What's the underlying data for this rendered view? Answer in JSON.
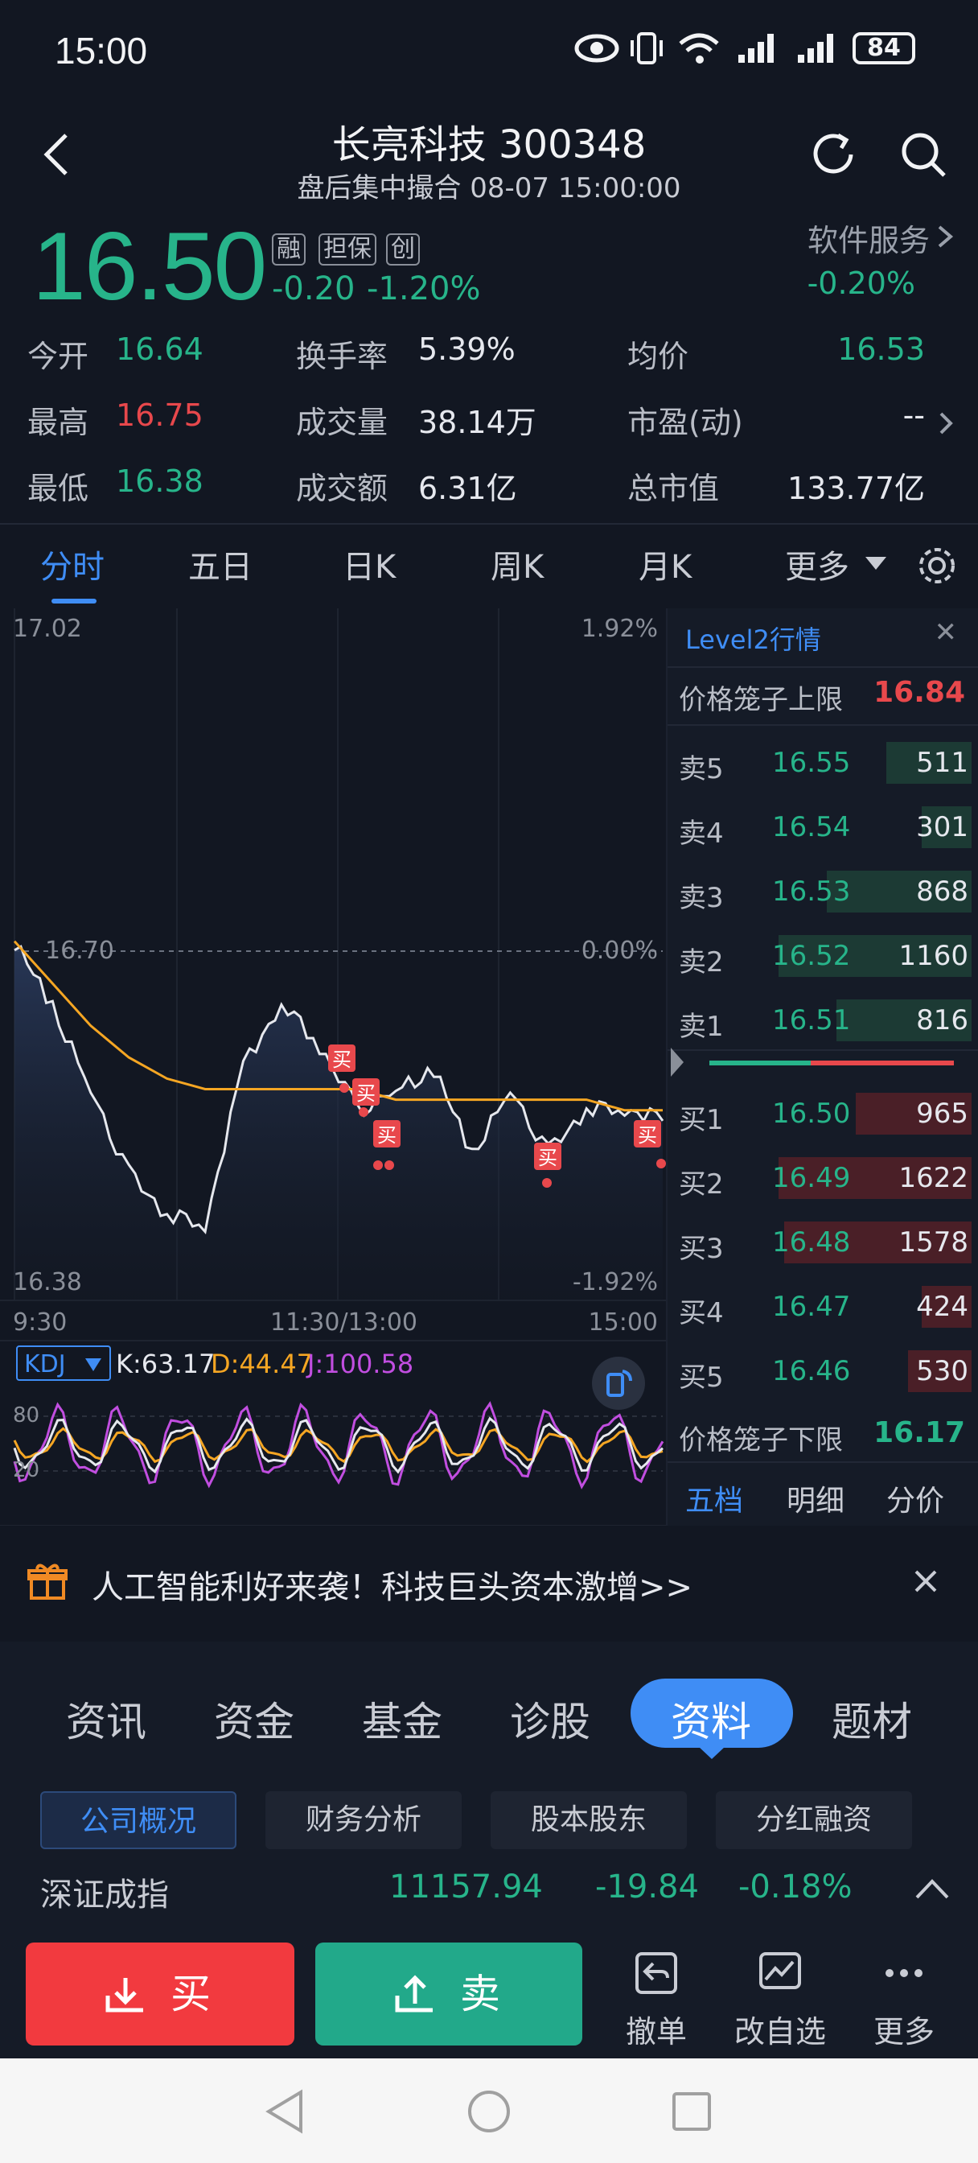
{
  "status_bar": {
    "time": "15:00",
    "battery": "84"
  },
  "header": {
    "title": "长亮科技 300348",
    "subtitle": "盘后集中撮合 08-07 15:00:00"
  },
  "quote": {
    "price": "16.50",
    "tags": [
      "融",
      "担保",
      "创"
    ],
    "change": "-0.20",
    "change_pct": "-1.20%",
    "sector": "软件服务",
    "sector_change": "-0.20%"
  },
  "stats": [
    {
      "label": "今开",
      "value": "16.64",
      "color": "green"
    },
    {
      "label": "换手率",
      "value": "5.39%",
      "color": "white"
    },
    {
      "label": "均价",
      "value": "16.53",
      "color": "green"
    },
    {
      "label": "最高",
      "value": "16.75",
      "color": "red"
    },
    {
      "label": "成交量",
      "value": "38.14万",
      "color": "white"
    },
    {
      "label": "市盈(动)",
      "value": "--",
      "color": "white"
    },
    {
      "label": "最低",
      "value": "16.38",
      "color": "green"
    },
    {
      "label": "成交额",
      "value": "6.31亿",
      "color": "white"
    },
    {
      "label": "总市值",
      "value": "133.77亿",
      "color": "white"
    }
  ],
  "chart_tabs": [
    "分时",
    "五日",
    "日K",
    "周K",
    "月K",
    "更多"
  ],
  "intraday_chart": {
    "price_top": "17.02",
    "price_mid": "16.70",
    "price_bottom": "16.38",
    "pct_top": "1.92%",
    "pct_mid": "0.00%",
    "pct_bottom": "-1.92%",
    "time_start": "9:30",
    "time_mid": "11:30/13:00",
    "time_end": "15:00",
    "marker_label": "买"
  },
  "kdj": {
    "name": "KDJ",
    "k": "K:63.17",
    "d": "D:44.47",
    "j": "J:100.58",
    "lvl80": "80",
    "lvl20": "20"
  },
  "chart_data": {
    "type": "line",
    "title": "",
    "x": [
      "9:30",
      "11:30/13:00",
      "15:00"
    ],
    "ylim": [
      16.38,
      17.02
    ],
    "series": [
      {
        "values": [
          16.72,
          16.66,
          16.58,
          16.5,
          16.46,
          16.45,
          16.6,
          16.66,
          16.62,
          16.56,
          16.58,
          16.6,
          16.52,
          16.58,
          16.52,
          16.56,
          16.56,
          16.55
        ]
      },
      {
        "values": [
          16.72,
          16.68,
          16.64,
          16.61,
          16.59,
          16.58,
          16.58,
          16.58,
          16.58,
          16.58,
          16.57,
          16.57,
          16.57,
          16.57,
          16.57,
          16.57,
          16.56,
          16.56
        ]
      }
    ]
  },
  "level2": {
    "title": "Level2行情",
    "upper_limit_label": "价格笼子上限",
    "upper_limit": "16.84",
    "lower_limit_label": "价格笼子下限",
    "lower_limit": "16.17",
    "asks": [
      {
        "label": "卖5",
        "price": "16.55",
        "vol": "511",
        "fill": 0.44
      },
      {
        "label": "卖4",
        "price": "16.54",
        "vol": "301",
        "fill": 0.26
      },
      {
        "label": "卖3",
        "price": "16.53",
        "vol": "868",
        "fill": 0.75
      },
      {
        "label": "卖2",
        "price": "16.52",
        "vol": "1160",
        "fill": 1.0
      },
      {
        "label": "卖1",
        "price": "16.51",
        "vol": "816",
        "fill": 0.7
      }
    ],
    "bids": [
      {
        "label": "买1",
        "price": "16.50",
        "vol": "965",
        "fill": 0.6
      },
      {
        "label": "买2",
        "price": "16.49",
        "vol": "1622",
        "fill": 1.0
      },
      {
        "label": "买3",
        "price": "16.48",
        "vol": "1578",
        "fill": 0.97
      },
      {
        "label": "买4",
        "price": "16.47",
        "vol": "424",
        "fill": 0.26
      },
      {
        "label": "买5",
        "price": "16.46",
        "vol": "530",
        "fill": 0.33
      }
    ],
    "tabs": [
      "五档",
      "明细",
      "分价"
    ]
  },
  "banner": {
    "text": "人工智能利好来袭！科技巨头资本激增>>"
  },
  "info_tabs": [
    "资讯",
    "资金",
    "基金",
    "诊股",
    "资料",
    "题材"
  ],
  "sub_tabs": [
    "公司概况",
    "财务分析",
    "股本股东",
    "分红融资"
  ],
  "index_bar": {
    "name": "深证成指",
    "value": "11157.94",
    "change": "-19.84",
    "pct": "-0.18%"
  },
  "actions": {
    "buy": "买",
    "sell": "卖",
    "cancel": "撤单",
    "edit_watch": "改自选",
    "more": "更多"
  },
  "colors": {
    "up": "#e8484c",
    "down": "#27b48a",
    "accent": "#3f8df5",
    "avg_line": "#f5a623"
  }
}
